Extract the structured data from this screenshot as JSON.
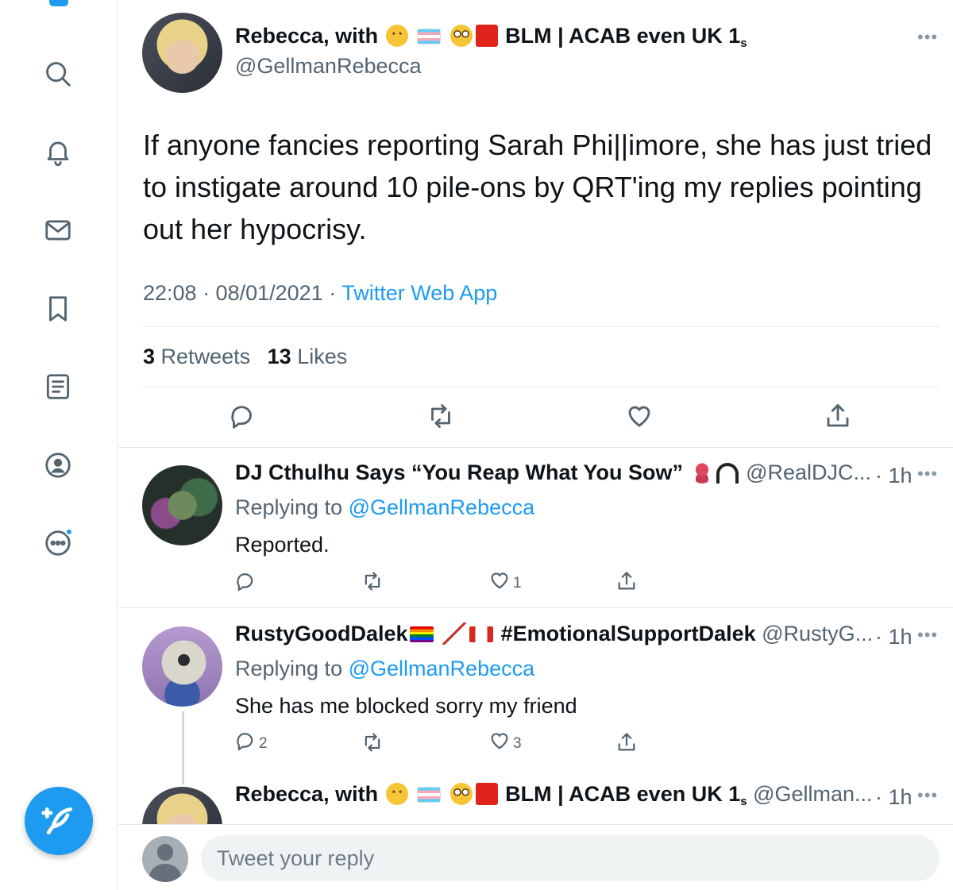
{
  "nav": {
    "items": [
      {
        "name": "search-icon"
      },
      {
        "name": "notifications-bell-icon"
      },
      {
        "name": "messages-mail-icon"
      },
      {
        "name": "bookmarks-icon"
      },
      {
        "name": "lists-icon"
      },
      {
        "name": "profile-icon"
      },
      {
        "name": "more-options-icon"
      }
    ],
    "compose_icon": "compose-feather-icon",
    "accent": "#1d9bf0"
  },
  "focused_tweet": {
    "author_name": "Rebecca, with",
    "author_name_suffix": "BLM | ACAB even UK 1",
    "author_name_subscript": "s",
    "author_handle": "@GellmanRebecca",
    "body": "If anyone fancies reporting Sarah Phi||imore, she has just tried to instigate around 10 pile-ons by QRT'ing my replies pointing out her hypocrisy.",
    "time": "22:08 · 08/01/2021 · ",
    "source": "Twitter Web App",
    "retweets_count": "3",
    "retweets_label": "Retweets",
    "likes_count": "13",
    "likes_label": "Likes"
  },
  "replies": [
    {
      "author_name": "DJ Cthulhu Says “You Reap What You Sow”",
      "author_handle": "@RealDJC...",
      "time": "· 1h",
      "replying_label": "Replying to",
      "replying_to": "@GellmanRebecca",
      "text": "Reported.",
      "reply_count": "",
      "retweet_count": "",
      "like_count": "1"
    },
    {
      "author_name": "RustyGoodDalek",
      "author_name_suffix": "#EmotionalSupportDalek",
      "author_handle": "@RustyG...",
      "time": "· 1h",
      "replying_label": "Replying to",
      "replying_to": "@GellmanRebecca",
      "text": "She has me blocked sorry my friend",
      "reply_count": "2",
      "retweet_count": "",
      "like_count": "3"
    },
    {
      "author_name": "Rebecca, with",
      "author_name_suffix": "BLM | ACAB even UK 1",
      "author_name_subscript": "s",
      "author_handle": "@Gellman...",
      "time": "· 1h"
    }
  ],
  "reply_box": {
    "placeholder": "Tweet your reply"
  }
}
